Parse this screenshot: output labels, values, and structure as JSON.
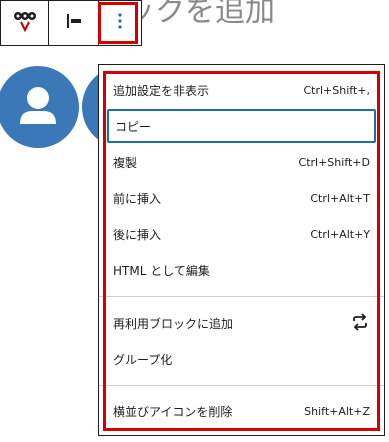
{
  "background": {
    "title": "ックを追加"
  },
  "toolbar": {
    "buttons": [
      {
        "name": "block-type-button",
        "icon": "block-type-icon"
      },
      {
        "name": "align-button",
        "icon": "align-left-icon"
      },
      {
        "name": "options-button",
        "icon": "kebab-menu-icon"
      }
    ]
  },
  "colors": {
    "accent": "#d40000",
    "focus": "#1e6fa8",
    "avatar": "#3a78b8"
  },
  "menu": {
    "group1": [
      {
        "label": "追加設定を非表示",
        "shortcut": "Ctrl+Shift+,"
      },
      {
        "label": "コピー",
        "shortcut": ""
      },
      {
        "label": "複製",
        "shortcut": "Ctrl+Shift+D"
      },
      {
        "label": "前に挿入",
        "shortcut": "Ctrl+Alt+T"
      },
      {
        "label": "後に挿入",
        "shortcut": "Ctrl+Alt+Y"
      },
      {
        "label": "HTML として編集",
        "shortcut": ""
      }
    ],
    "group2": [
      {
        "label": "再利用ブロックに追加",
        "icon": "reusable-icon"
      },
      {
        "label": "グループ化"
      }
    ],
    "group3": [
      {
        "label": "横並びアイコンを削除",
        "shortcut": "Shift+Alt+Z"
      }
    ]
  }
}
